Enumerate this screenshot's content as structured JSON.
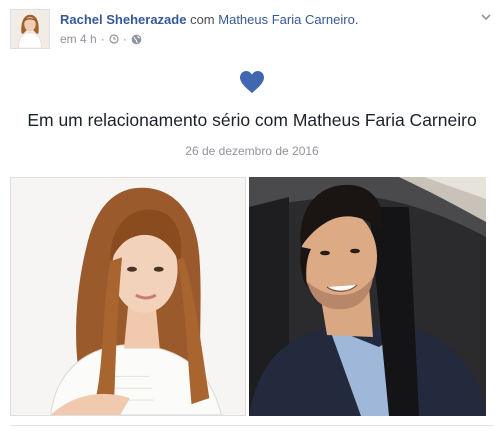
{
  "post": {
    "author": "Rachel Sheherazade",
    "with_text": "com",
    "tagged_person": "Matheus Faria Carneiro",
    "tagged_suffix": ".",
    "timestamp": "em 4 h",
    "privacy_icon": "globe-icon",
    "options_icon": "chevron-down-icon"
  },
  "life_event": {
    "icon": "heart-icon",
    "icon_color": "#4267b2",
    "title": "Em um relacionamento sério com Matheus Faria Carneiro",
    "date": "26 de dezembro de 2016"
  },
  "photos": [
    {
      "subject": "Rachel Sheherazade"
    },
    {
      "subject": "Matheus Faria Carneiro"
    }
  ],
  "colors": {
    "link": "#365899",
    "meta": "#90949c",
    "text": "#1d2129"
  }
}
